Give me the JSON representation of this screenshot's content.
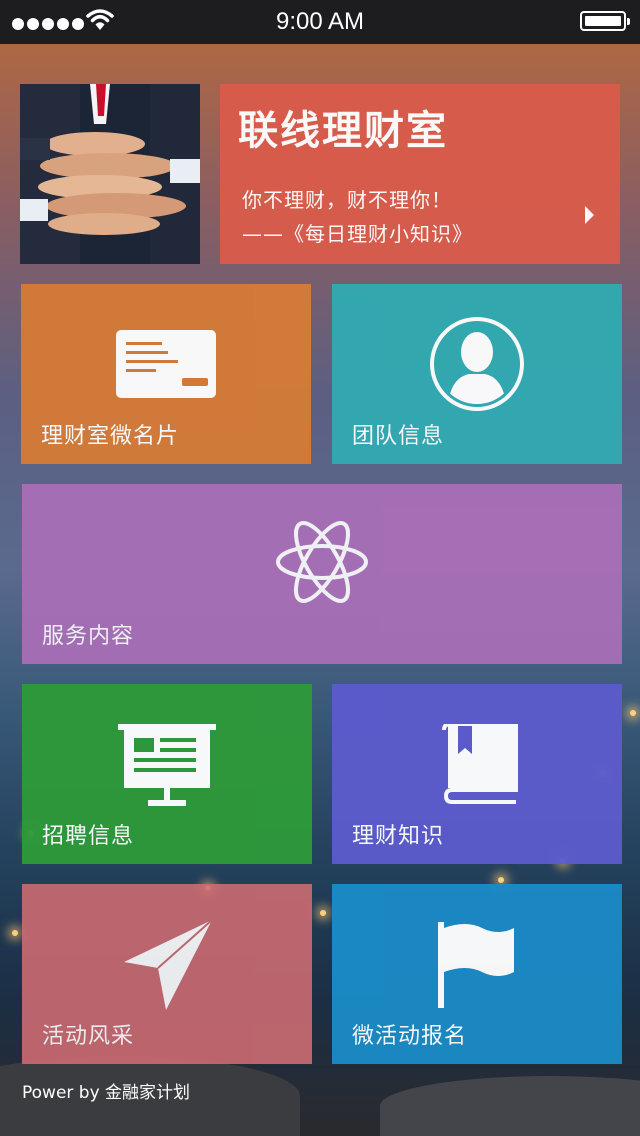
{
  "status_bar": {
    "time": "9:00 AM"
  },
  "banner": {
    "title": "联线理财室",
    "line1": "你不理财，财不理你！",
    "line2": "——《每日理财小知识》"
  },
  "tiles": {
    "card": "理财室微名片",
    "team": "团队信息",
    "service": "服务内容",
    "recruit": "招聘信息",
    "knowledge": "理财知识",
    "activities": "活动风采",
    "signup": "微活动报名"
  },
  "footer": "Power by 金融家计划",
  "colors": {
    "banner": "#d95b4b",
    "card": "#d57b37",
    "team": "#31aab1",
    "service": "#ad6fb9",
    "recruit": "#2e9a3a",
    "knowledge": "#5c5bcd",
    "activities": "#cc6b72",
    "signup": "#1a8bc7"
  },
  "icons": {
    "card": "business-card-icon",
    "team": "person-avatar-icon",
    "service": "atom-icon",
    "recruit": "presentation-board-icon",
    "knowledge": "bookmarked-book-icon",
    "activities": "paper-plane-icon",
    "signup": "flag-icon"
  }
}
